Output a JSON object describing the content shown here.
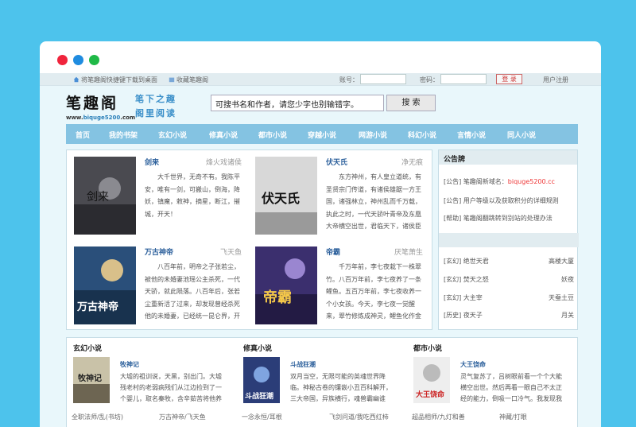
{
  "topbar": {
    "home_link": "将笔趣阁快捷键下载到桌面",
    "bookmark_link": "收藏笔趣阁",
    "account_label": "账号：",
    "password_label": "密码：",
    "login_button": "登 录",
    "register_link": "用户注册"
  },
  "header": {
    "logo": "笔趣阁",
    "url_prefix": "www.",
    "url_domain": "biquge5200",
    "url_suffix": ".com",
    "slogan_top": "笔下之趣",
    "slogan_bottom": "阁里阅读",
    "search_value": "可搜书名和作者，请您少字也别输错字。",
    "search_button": "搜 索"
  },
  "nav": [
    "首页",
    "我的书架",
    "玄幻小说",
    "修真小说",
    "都市小说",
    "穿越小说",
    "网游小说",
    "科幻小说",
    "言情小说",
    "同人小说"
  ],
  "featured": [
    {
      "title": "剑来",
      "author": "烽火戏诸侯",
      "desc": "大千世界，无奇不有。我陈平安，唯有一剑，可搬山，倒海，降妖，镇魔，敕神，摘星，断江，摧城，开天！",
      "cover_text": "剑来"
    },
    {
      "title": "伏天氏",
      "author": "净无痕",
      "desc": "东方神州，有人皇立道统，有圣贤宗门传道，有诸侯雄踞一方王国，诸强林立，神州乱而千万载，执此之时，一代天骄叶青帝及东凰大帝横空出世，君临天下，诸侯臣服，东方神州一统！",
      "cover_text": "伏天氏"
    },
    {
      "title": "万古神帝",
      "author": "飞天鱼",
      "desc": "八百年前，明帝之子张若尘，被他的未婚妻池瑶公主杀死，一代天骄，就此陨落。八百年后，张若尘重新活了过来，却发现曾经杀死他的未婚妻，已经统一昆仑界，开辟出第一中央帝国，号称\"池瑶女皇\"。",
      "cover_text": "万古神帝"
    },
    {
      "title": "帝霸",
      "author": "厌笔萧生",
      "desc": "千万年前，李七夜栽下一株翠竹。八百万年前，李七夜养了一条鲤鱼。五百万年前，李七夜收养一个小女孩。今天，李七夜一觉醒来，翠竹修炼成神灵，鲤鱼化作金龙，小女孩成为九界女帝。",
      "cover_text": "帝霸"
    }
  ],
  "notice": {
    "title": "公告牌",
    "lines": [
      {
        "tag": "[公告]",
        "text": "笔趣阁新域名：",
        "highlight": "biquge5200.cc"
      },
      {
        "tag": "[公告]",
        "text": "用户等级以及获取积分的详细规则",
        "highlight": ""
      },
      {
        "tag": "[帮助]",
        "text": "笔趣阁翻跳转到别站的处理办法",
        "highlight": ""
      }
    ],
    "recommend": [
      {
        "book": "[玄幻] 绝世天君",
        "author": "高楼大厦"
      },
      {
        "book": "[玄幻] 焚天之怒",
        "author": "妖夜"
      },
      {
        "book": "[玄幻] 大主宰",
        "author": "天蚕土豆"
      },
      {
        "book": "[历史] 夜天子",
        "author": "月关"
      }
    ]
  },
  "categories": [
    {
      "name": "玄幻小说",
      "book": "牧神记",
      "desc": "大墟的祖训说，天黑，别出门。大墟残老村的老弱病残们从江边捡到了一个婴儿，取名秦牧，含辛茹苦将他养大……",
      "cover_text": "牧神记",
      "foot_left": "全职法师/乱(书坊)",
      "foot_right": "万古神帝/飞天鱼"
    },
    {
      "name": "修真小说",
      "book": "斗战狂潮",
      "desc": "双月当空，无限可能的英魂世界降临。神秘古卷的镶嵌小丑百科解开，三大帝国，异族横行，魂兽霸幽谁主……",
      "cover_text": "斗战狂潮",
      "foot_left": "一念永恒/耳根",
      "foot_right": "飞剑问道/我吃西红柿"
    },
    {
      "name": "都市小说",
      "book": "大王饶命",
      "desc": "灵气复苏了，吕树眼前看一个个大能横空出世。然后再看一眼自己不太正经的能力，倒吸一口冷气。我发现我同为…",
      "cover_text": "大王饶命",
      "foot_left": "超品相师/九灯和善",
      "foot_right": "神藏/打眼"
    }
  ]
}
